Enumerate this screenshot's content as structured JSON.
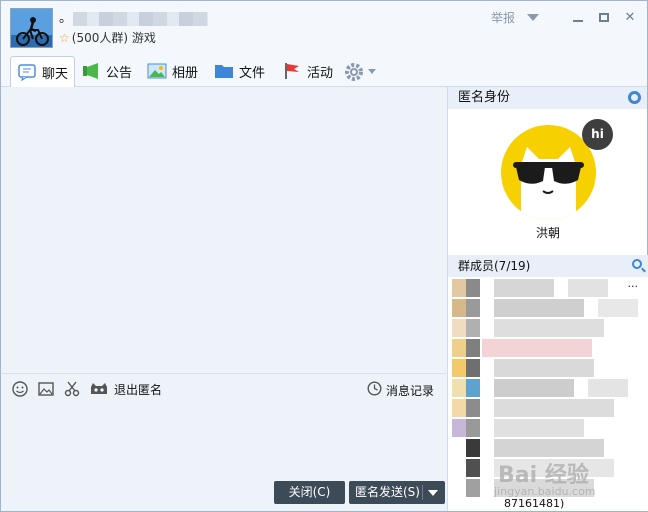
{
  "header": {
    "group_name": "。",
    "group_info": "(500人群) 游戏",
    "report_label": "举报"
  },
  "tabs": [
    {
      "label": "聊天"
    },
    {
      "label": "公告"
    },
    {
      "label": "相册"
    },
    {
      "label": "文件"
    },
    {
      "label": "活动"
    }
  ],
  "toolbar": {
    "exit_anon_label": "退出匿名",
    "history_label": "消息记录"
  },
  "buttons": {
    "close_label": "关闭(C)",
    "send_label": "匿名发送(S)"
  },
  "right_panel": {
    "anon_title": "匿名身份",
    "anon_bubble": "hi",
    "anon_name": "洪朝",
    "members_title": "群成员(7/19)",
    "more_label": "···"
  },
  "watermark": {
    "text": "Bai 经验",
    "sub": "jingyan.baidu.com",
    "member_tail": "87161481)"
  },
  "colors": {
    "accent": "#3f86d8",
    "button_bg": "#3d4a57",
    "avatar_yellow": "#f7d000"
  }
}
